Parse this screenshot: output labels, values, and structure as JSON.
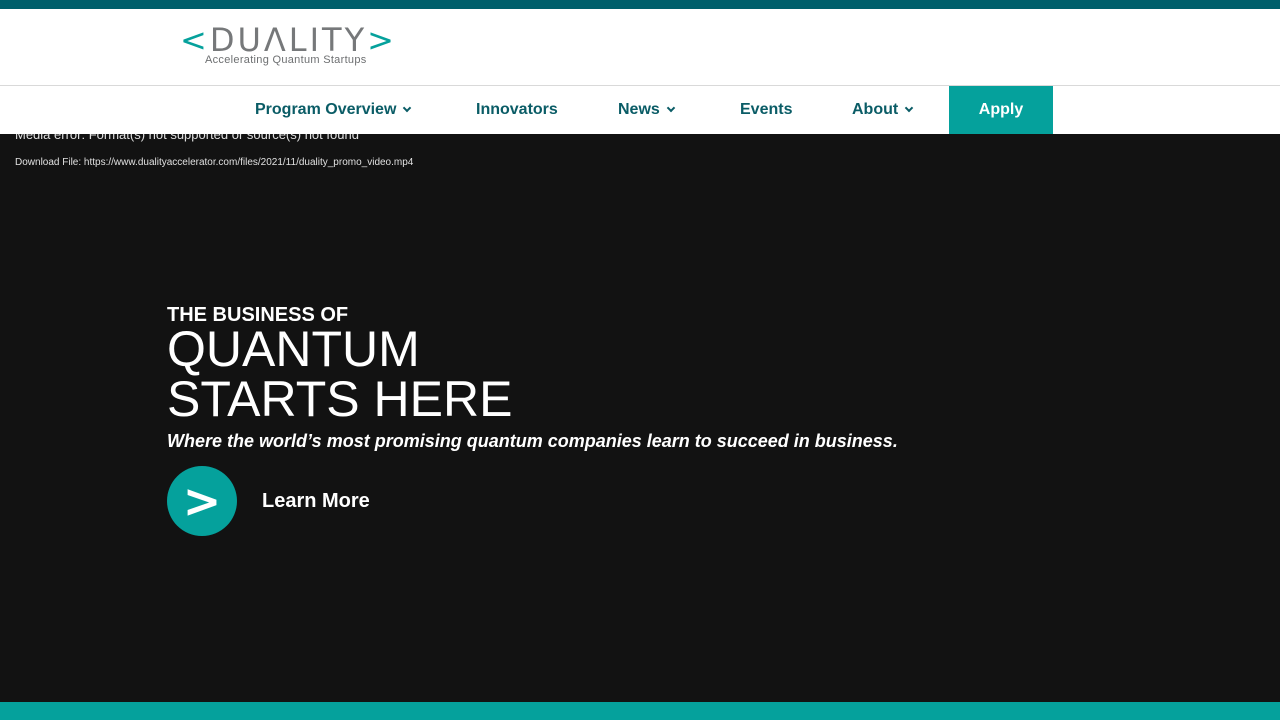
{
  "colors": {
    "brand_teal": "#05a19c",
    "nav_text": "#0a5c66",
    "top_bar": "#005f6b",
    "hero_background": "#121212"
  },
  "logo": {
    "open_bracket": "<",
    "wordmark": "DUΛLITY",
    "close_bracket": ">",
    "tagline": "Accelerating Quantum Startups"
  },
  "nav": {
    "items": [
      {
        "label": "Program Overview",
        "has_dropdown": true,
        "icon": "chevron-down-icon"
      },
      {
        "label": "Innovators",
        "has_dropdown": false
      },
      {
        "label": "News",
        "has_dropdown": true,
        "icon": "chevron-down-icon"
      },
      {
        "label": "Events",
        "has_dropdown": false
      },
      {
        "label": "About",
        "has_dropdown": true,
        "icon": "chevron-down-icon"
      }
    ],
    "apply_label": "Apply"
  },
  "media": {
    "error_text": "Media error: Format(s) not supported or source(s) not found",
    "download_text": "Download File: https://www.dualityaccelerator.com/files/2021/11/duality_promo_video.mp4"
  },
  "hero": {
    "eyebrow": "THE BUSINESS OF",
    "line1": "QUANTUM",
    "line2": "STARTS HERE",
    "subtitle": "Where the world’s most promising quantum companies learn to succeed in business.",
    "cta_icon_glyph": ">",
    "cta_label": "Learn More"
  }
}
